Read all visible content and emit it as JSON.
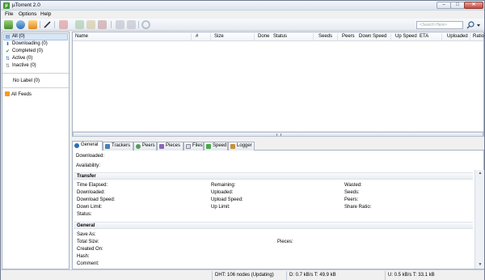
{
  "window": {
    "title": "µTorrent 2.0",
    "app_icon_letter": "µ",
    "minimize_glyph": "–",
    "maximize_glyph": "□",
    "close_glyph": "✕"
  },
  "menu": [
    "File",
    "Options",
    "Help"
  ],
  "toolbar": {
    "search_placeholder": "<Search Here>",
    "icons": [
      "add-torrent-icon",
      "add-url-icon",
      "create-torrent-icon",
      "edit-icon",
      "remove-icon",
      "start-icon",
      "pause-icon",
      "stop-icon",
      "up-icon",
      "down-icon",
      "rss-icon"
    ]
  },
  "sidebar": {
    "categories": [
      {
        "label": "All (0)",
        "icon": "all-icon",
        "selected": true
      },
      {
        "label": "Downloading (0)",
        "icon": "downloading-icon"
      },
      {
        "label": "Completed (0)",
        "icon": "completed-icon"
      },
      {
        "label": "Active (0)",
        "icon": "active-icon"
      },
      {
        "label": "Inactive (0)",
        "icon": "inactive-icon"
      }
    ],
    "labels": [
      {
        "label": "No Label (0)"
      }
    ],
    "feeds": [
      {
        "label": "All Feeds",
        "icon": "feed-icon"
      }
    ]
  },
  "torrent_list": {
    "columns": [
      "Name",
      "#",
      "Size",
      "Done",
      "Status",
      "Seeds",
      "Peers",
      "Down Speed",
      "Up Speed",
      "ETA",
      "Uploaded",
      "Ratio"
    ]
  },
  "tabs": [
    {
      "label": "General",
      "icon": "info-icon",
      "active": true
    },
    {
      "label": "Trackers",
      "icon": "trackers-icon"
    },
    {
      "label": "Peers",
      "icon": "peers-icon"
    },
    {
      "label": "Pieces",
      "icon": "pieces-icon"
    },
    {
      "label": "Files",
      "icon": "files-icon"
    },
    {
      "label": "Speed",
      "icon": "speed-icon"
    },
    {
      "label": "Logger",
      "icon": "logger-icon"
    }
  ],
  "general": {
    "downloaded_label": "Downloaded:",
    "availability_label": "Availability:",
    "transfer_title": "Transfer",
    "transfer": {
      "col1": [
        "Time Elapsed:",
        "Downloaded:",
        "Download Speed:",
        "Down Limit:",
        "Status:"
      ],
      "col2": [
        "Remaining:",
        "Uploaded:",
        "Upload Speed:",
        "Up Limit:"
      ],
      "col3": [
        "Wasted:",
        "Seeds:",
        "Peers:",
        "Share Ratio:"
      ]
    },
    "general_title": "General",
    "general_fields": [
      "Save As:",
      "Total Size:",
      "Created On:",
      "Hash:",
      "Comment:"
    ],
    "pieces_label": "Pieces:"
  },
  "statusbar": {
    "dht": "DHT: 106 nodes (Updating)",
    "download": "D: 0.7 kB/s T: 49.9 kB",
    "upload": "U: 0.5 kB/s T: 33.1 kB"
  },
  "colors": {
    "accent": "#3f9a2f",
    "selection": "#d9e6f6",
    "border": "#a7b4c5"
  }
}
